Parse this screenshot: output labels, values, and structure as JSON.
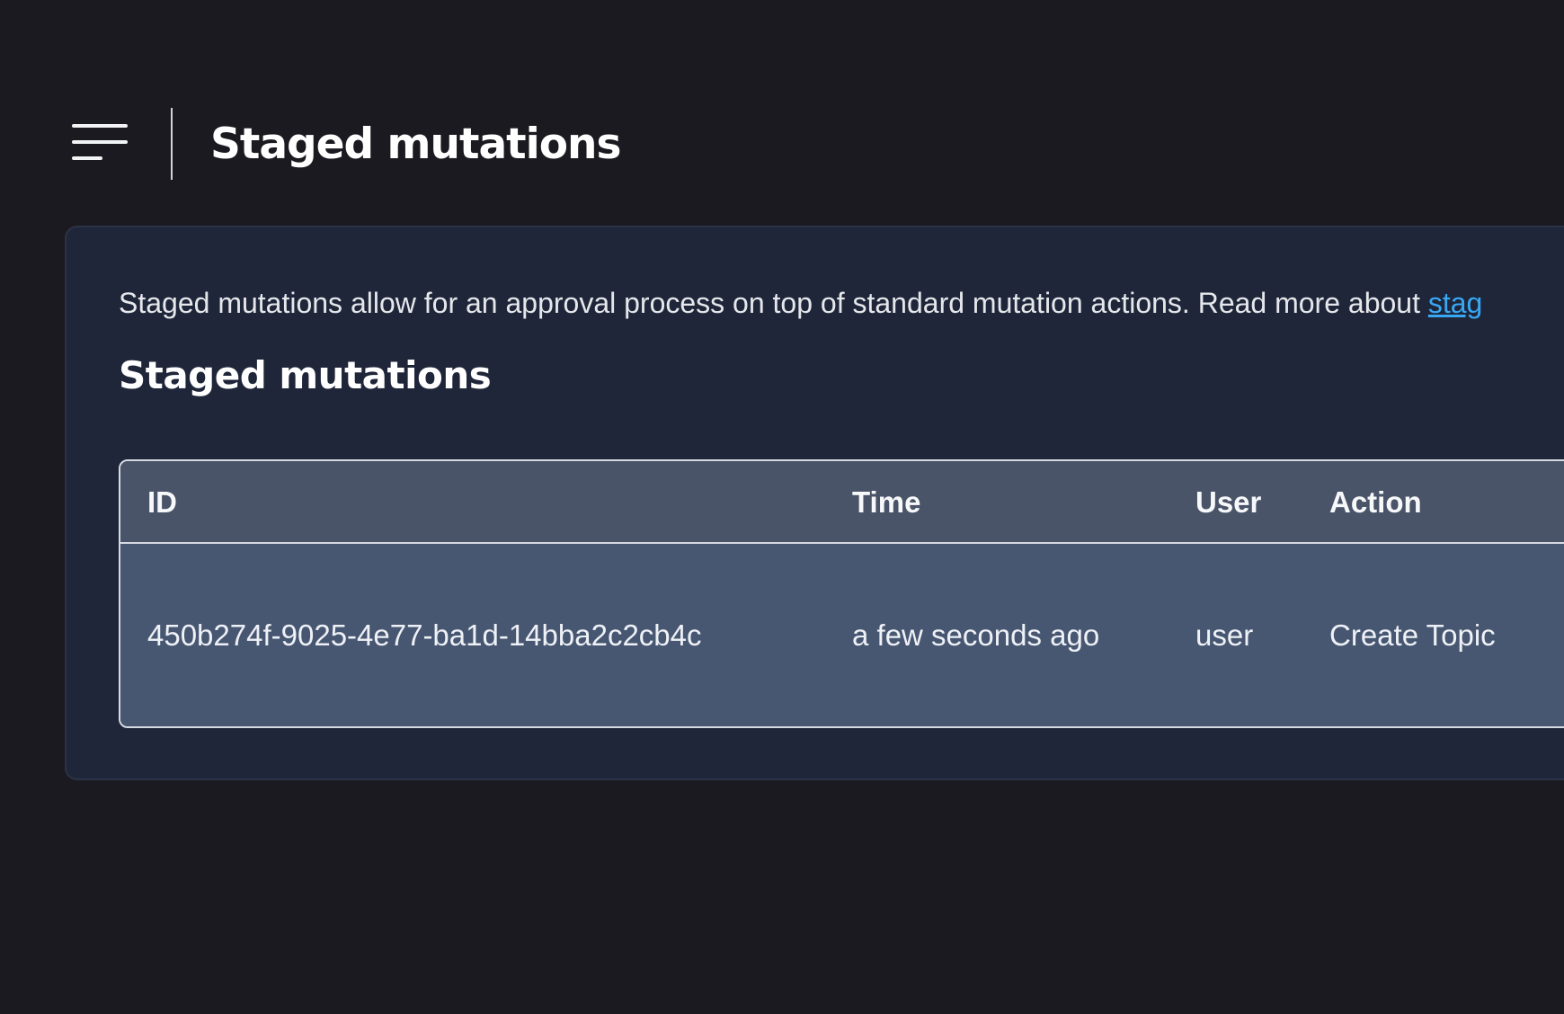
{
  "header": {
    "title": "Staged mutations",
    "menu_icon": "hamburger-menu-icon"
  },
  "card": {
    "description_text": "Staged mutations allow for an approval process on top of standard mutation actions. Read more about ",
    "description_link": "stag",
    "section_title": "Staged mutations",
    "table": {
      "columns": [
        "ID",
        "Time",
        "User",
        "Action"
      ],
      "rows": [
        {
          "id": "450b274f-9025-4e77-ba1d-14bba2c2cb4c",
          "time": "a few seconds ago",
          "user": "user",
          "action": "Create Topic"
        }
      ]
    }
  },
  "colors": {
    "background": "#1b1a20",
    "card": "#1f2639",
    "table_header": "#4a5468",
    "table_row": "#475671",
    "link": "#38a8f5"
  }
}
